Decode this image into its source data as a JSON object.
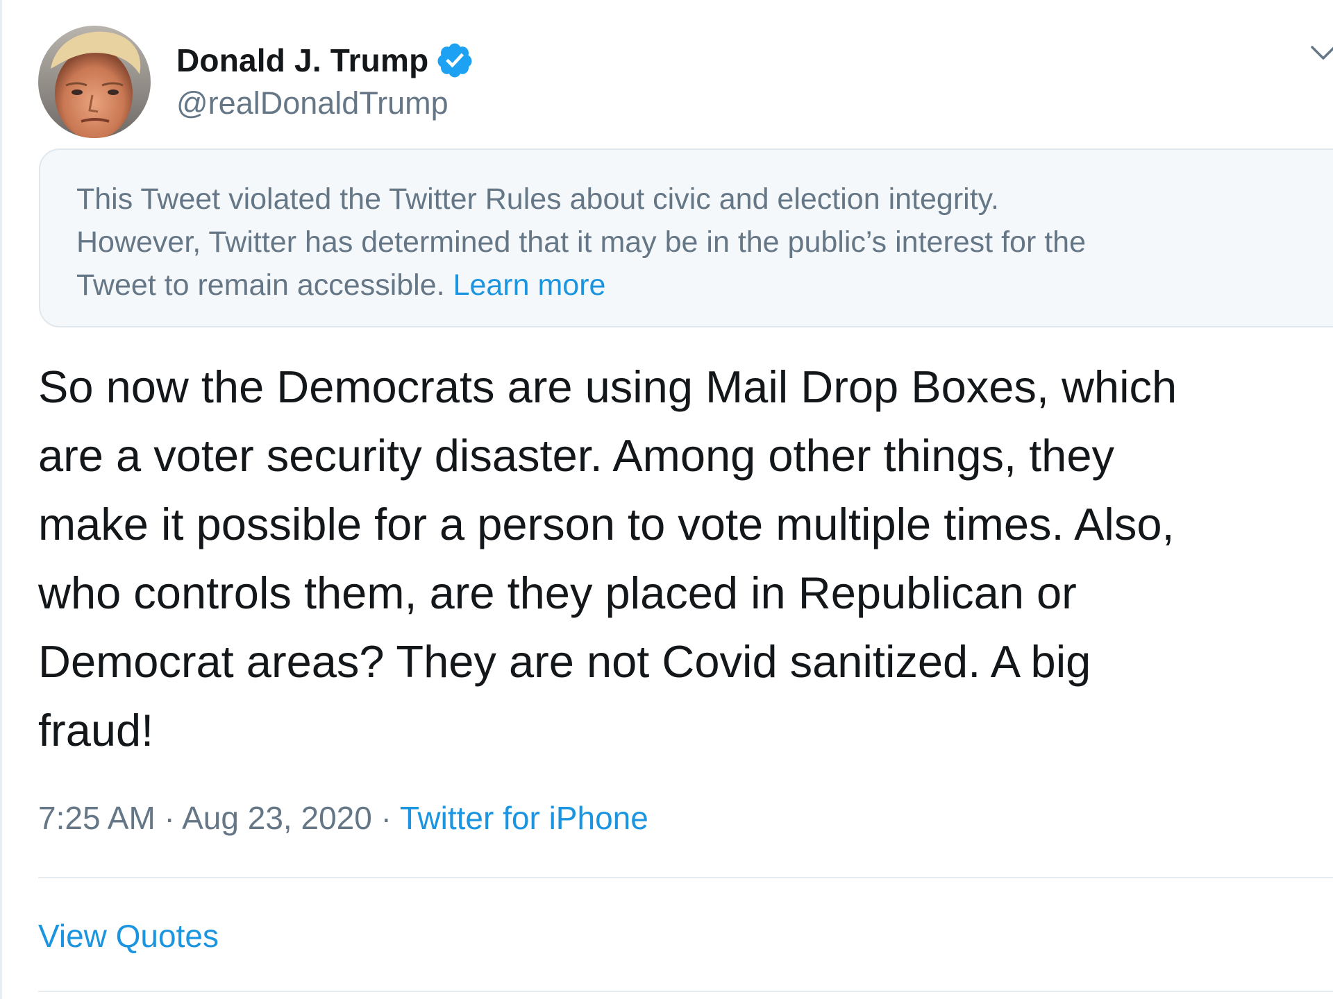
{
  "author": {
    "display_name": "Donald J. Trump",
    "handle": "@realDonaldTrump",
    "verified": true,
    "verified_color": "#1da1f2"
  },
  "notice": {
    "lines": [
      "This Tweet violated the Twitter Rules about civic and election integrity.",
      "However, Twitter has determined that it may be in the public’s interest for the",
      "Tweet to remain accessible. "
    ],
    "link_label": "Learn more"
  },
  "tweet": {
    "lines": [
      "So now the Democrats are using Mail Drop Boxes, which",
      "are a voter security disaster. Among other things, they",
      "make it possible for a person to vote multiple times. Also,",
      "who controls them, are they placed in Republican or",
      "Democrat areas? They are not Covid sanitized. A big",
      "fraud!"
    ]
  },
  "meta": {
    "time": "7:25 AM",
    "separator": " · ",
    "date": "Aug 23, 2020",
    "source": "Twitter for iPhone"
  },
  "actions": {
    "view_quotes": "View Quotes"
  },
  "icons": {
    "verified": "verified-badge-icon",
    "menu": "chevron-down-icon"
  },
  "colors": {
    "link": "#1b95e0",
    "secondary_text": "#657786",
    "primary_text": "#14171a",
    "notice_bg": "#f5f8fa"
  }
}
